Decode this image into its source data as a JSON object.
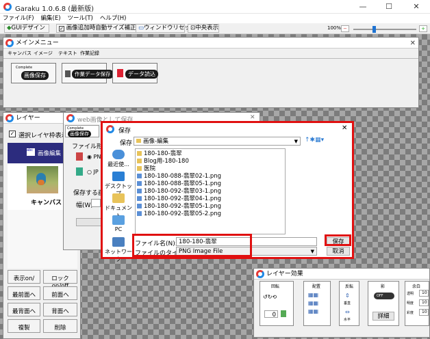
{
  "app": {
    "title": "Garaku 1.0.6.8 (最新版)",
    "min": "—",
    "max": "☐",
    "close": "✕"
  },
  "menu": [
    "ファイル(F)",
    "編集(E)",
    "ツール(T)",
    "ヘルプ(H)"
  ],
  "toolbar": {
    "gui": "GUIデザイン",
    "autosize": "画像追加時自動サイズ補正",
    "window_reset": "ウィンドウリセット",
    "center": "中央表示",
    "zoom": "100%"
  },
  "main_menu": {
    "title": "メインメニュー",
    "tabs": [
      "キャンバス",
      "イメージ",
      "テキスト",
      "作業記録"
    ],
    "buttons": [
      {
        "label": "画像保存",
        "badge": "Complete"
      },
      {
        "label": "作業データ保存"
      },
      {
        "label": "データ読込"
      }
    ]
  },
  "layer": {
    "title": "レイヤー",
    "checkbox": "選択レイヤ枠表示",
    "item_label": "画像編集",
    "canvas_label": "キャンバス",
    "buttons": [
      "表示on/",
      "ロックon/off",
      "最前面へ",
      "前面へ",
      "最背面へ",
      "背面へ",
      "複製",
      "削除"
    ]
  },
  "web_dialog": {
    "title": "web画像として保存",
    "badge": "Complete",
    "button": "画像保存",
    "format_label": "ファイル形式",
    "radio1": "PN",
    "radio2": "JP",
    "size_label": "保存する画像",
    "width_label": "幅(W)"
  },
  "save_dialog": {
    "title": "保存",
    "location_label": "保存",
    "location": "画像-編集",
    "places": [
      "最近使...",
      "デスクトップ",
      "ドキュメント",
      "PC",
      "ネットワーク"
    ],
    "files": [
      {
        "name": "180-180-翡翠",
        "kind": "folder"
      },
      {
        "name": "Blog用-180-180",
        "kind": "folder"
      },
      {
        "name": "医院",
        "kind": "folder"
      },
      {
        "name": "180-180-088-翡翠02-1.png",
        "kind": "png"
      },
      {
        "name": "180-180-088-翡翠05-1.png",
        "kind": "png"
      },
      {
        "name": "180-180-092-翡翠03-1.png",
        "kind": "png"
      },
      {
        "name": "180-180-092-翡翠04-1.png",
        "kind": "png"
      },
      {
        "name": "180-180-092-翡翠05-1.png",
        "kind": "png"
      },
      {
        "name": "180-180-092-翡翠05-2.png",
        "kind": "png"
      }
    ],
    "filename_label": "ファイル名(N):",
    "filename_value": "180-180-翡翠",
    "filetype_label": "ファイルのタイプ(T):",
    "filetype_value": "PNG Image File",
    "save_button": "保存",
    "cancel_button": "取消"
  },
  "effects": {
    "title": "レイヤー効果",
    "groups": [
      "回転",
      "配置",
      "反転",
      "影",
      "余白"
    ],
    "spin_value": "0",
    "shadow_button": "詳細",
    "toggle": "OFF",
    "vertical": "垂直",
    "horizontal": "水平",
    "margin_labels": [
      "透明",
      "明度",
      "彩度"
    ],
    "margin_values": [
      "10",
      "10",
      "10"
    ]
  }
}
